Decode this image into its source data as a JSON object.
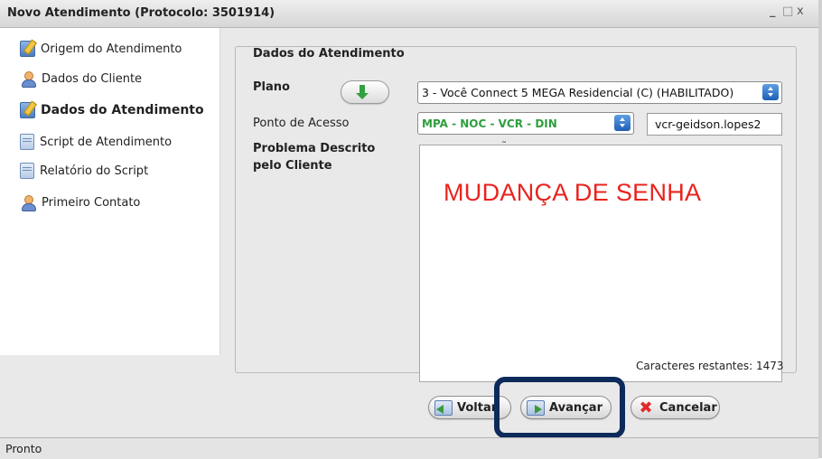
{
  "window": {
    "title": "Novo Atendimento  (Protocolo: 3501914)",
    "controls": {
      "minimize": "_",
      "maximize": "□",
      "close": "x"
    }
  },
  "sidebar": {
    "items": [
      {
        "label": "Origem do Atendimento",
        "icon": "edit-icon",
        "active": false
      },
      {
        "label": "Dados do Cliente",
        "icon": "user-icon",
        "active": false
      },
      {
        "label": "Dados do Atendimento",
        "icon": "edit-icon",
        "active": true
      },
      {
        "label": "Script de Atendimento",
        "icon": "sheet-icon",
        "active": false
      },
      {
        "label": "Relatório do Script",
        "icon": "sheet-icon",
        "active": false
      },
      {
        "label": "Primeiro Contato",
        "icon": "user-icon",
        "active": false
      }
    ]
  },
  "form": {
    "legend": "Dados do Atendimento",
    "plano_label": "Plano",
    "plano_value": "3 - Você Connect 5 MEGA Residencial (C) (HABILITADO)",
    "ponto_label": "Ponto de Acesso",
    "ponto_value": "MPA - NOC - VCR - DIN",
    "ponto_color": "#2e9e3e",
    "login_value": "vcr-geidson.lopes2",
    "problema_label_1": "Problema Descrito",
    "problema_label_2": "pelo Cliente",
    "problema_text": "MUDANÇA DE SENHA",
    "problema_text_color": "#e8231e",
    "counter_label": "Caracteres restantes:",
    "counter_value": "1473"
  },
  "buttons": {
    "back": "Voltar",
    "next": "Avançar",
    "cancel": "Cancelar"
  },
  "highlight_color": "#0d2a5a",
  "status": {
    "text": "Pronto"
  }
}
